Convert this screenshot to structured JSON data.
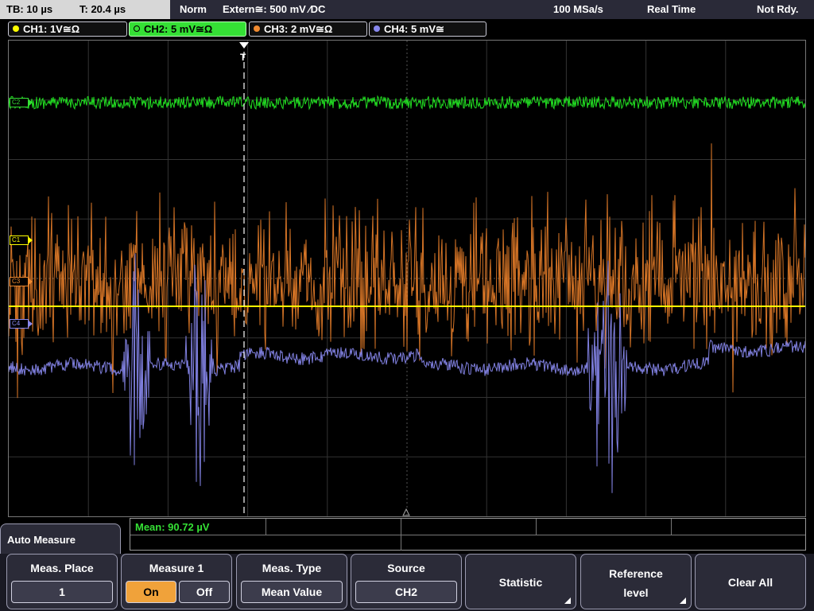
{
  "status": {
    "timebase": "TB: 10 µs",
    "trigger_time": "T: 20.4 µs",
    "mode": "Norm",
    "trigger_source": "Extern≅: 500 mV ⁄DC",
    "sample_rate": "100 MSa/s",
    "acq_mode": "Real Time",
    "state": "Not Rdy."
  },
  "channels": [
    {
      "label": "CH1: 1V≅Ω",
      "color": "#ffff00"
    },
    {
      "label": "CH2: 5 mV≅Ω",
      "color": "#35e035"
    },
    {
      "label": "CH3: 2 mV≅Ω",
      "color": "#f08a30"
    },
    {
      "label": "CH4: 5 mV≅",
      "color": "#8888ee"
    }
  ],
  "markers": {
    "c2": "C2",
    "c1": "C1",
    "c3": "C3",
    "c4": "C4",
    "trigger": "T"
  },
  "measurement": {
    "mean": "Mean: 90.72 µV"
  },
  "menu": {
    "title": "Auto Measure",
    "meas_place": {
      "label": "Meas. Place",
      "value": "1"
    },
    "measure1": {
      "label": "Measure 1",
      "on": "On",
      "off": "Off"
    },
    "meas_type": {
      "label": "Meas. Type",
      "value": "Mean Value"
    },
    "source": {
      "label": "Source",
      "value": "CH2"
    },
    "statistic": {
      "label": "Statistic"
    },
    "reference": {
      "label_line1": "Reference",
      "label_line2": "level"
    },
    "clear": {
      "label": "Clear All"
    }
  }
}
